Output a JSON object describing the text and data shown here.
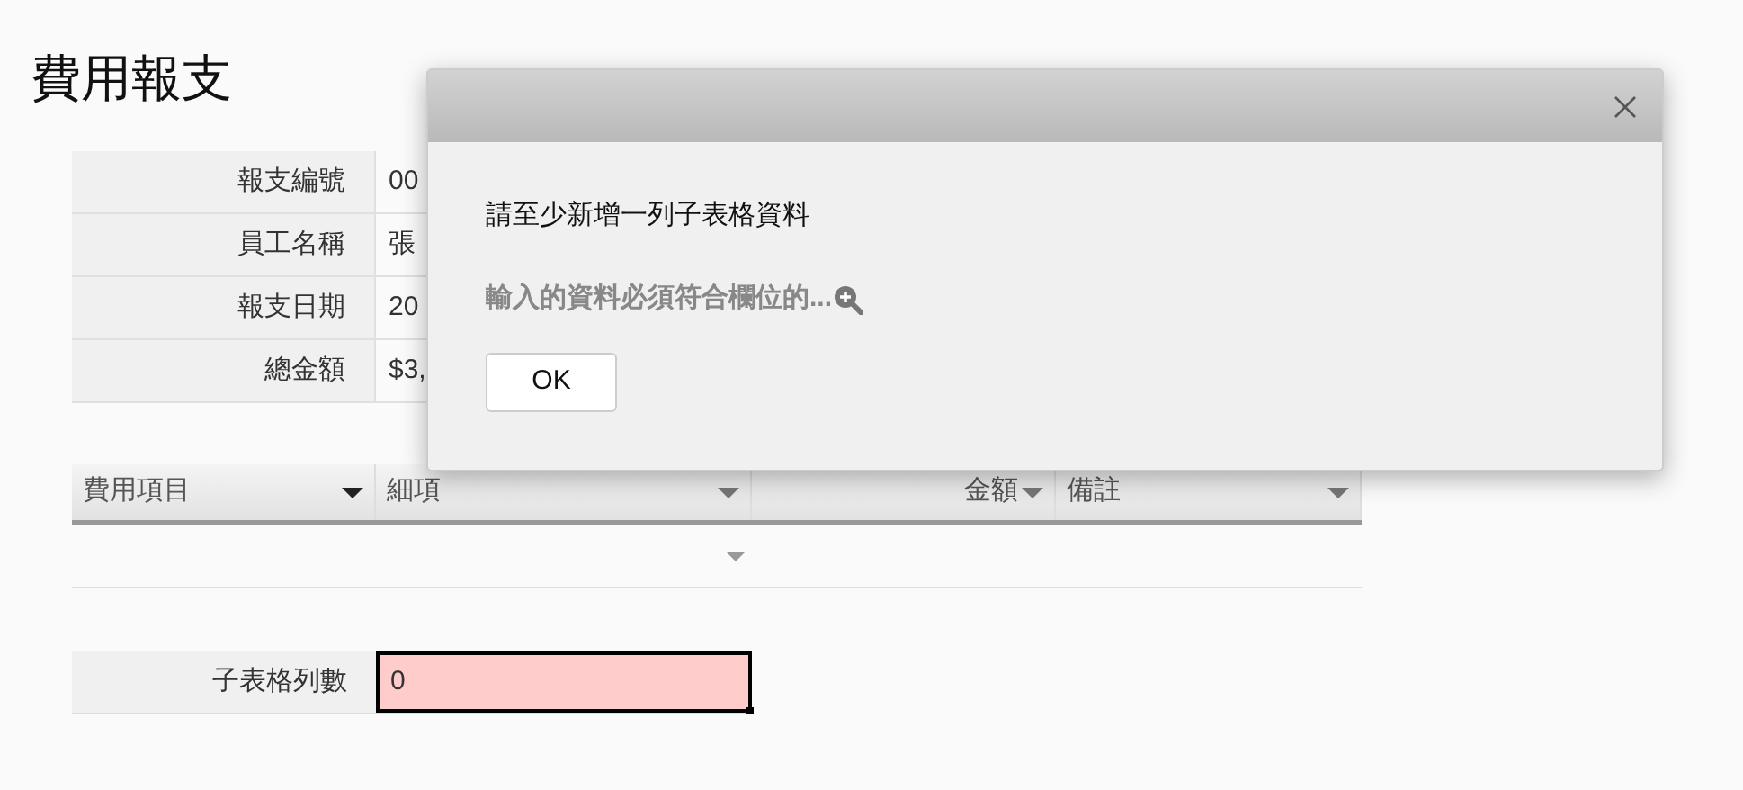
{
  "page": {
    "title": "費用報支"
  },
  "form_fields": [
    {
      "label": "報支編號",
      "value": "00"
    },
    {
      "label": "員工名稱",
      "value": "張"
    },
    {
      "label": "報支日期",
      "value": "20"
    },
    {
      "label": "總金額",
      "value": "$3,"
    }
  ],
  "grid": {
    "columns": [
      {
        "label": "費用項目",
        "kind": "text"
      },
      {
        "label": "細項",
        "kind": "text"
      },
      {
        "label": "金額",
        "kind": "number"
      },
      {
        "label": "備註",
        "kind": "text"
      }
    ]
  },
  "row_count": {
    "label": "子表格列數",
    "value": "0",
    "invalid": true
  },
  "dialog": {
    "message": "請至少新增一列子表格資料",
    "detail": "輸入的資料必須符合欄位的...",
    "button": "OK"
  }
}
